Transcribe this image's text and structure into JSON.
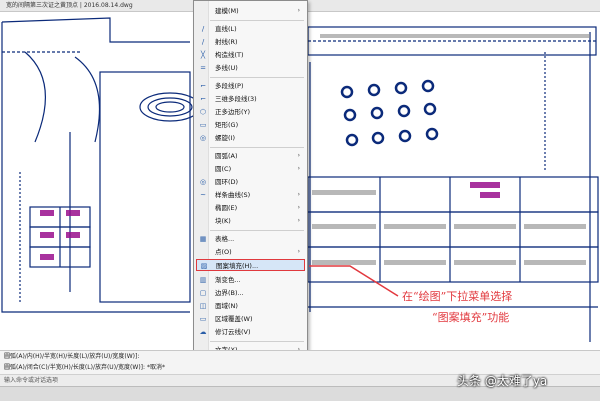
{
  "window": {
    "title": "宽的间隔第三次证之黄顶点 | 2016.08.14.dwg"
  },
  "menu": {
    "items": [
      {
        "label": "建模(M)",
        "arrow": "›",
        "icon": ""
      },
      {
        "label": "直线(L)",
        "arrow": "",
        "icon": "/"
      },
      {
        "label": "射线(R)",
        "arrow": "",
        "icon": "/"
      },
      {
        "label": "构造线(T)",
        "arrow": "",
        "icon": "╳"
      },
      {
        "label": "多线(U)",
        "arrow": "",
        "icon": "="
      },
      {
        "label": "多段线(P)",
        "arrow": "",
        "icon": "⌐"
      },
      {
        "label": "三维多段线(3)",
        "arrow": "",
        "icon": "⌐"
      },
      {
        "label": "正多边形(Y)",
        "arrow": "",
        "icon": "⬡"
      },
      {
        "label": "矩形(G)",
        "arrow": "",
        "icon": "▭"
      },
      {
        "label": "螺旋(I)",
        "arrow": "",
        "icon": "◎"
      },
      {
        "label": "圆弧(A)",
        "arrow": "›",
        "icon": ""
      },
      {
        "label": "圆(C)",
        "arrow": "›",
        "icon": ""
      },
      {
        "label": "圆环(D)",
        "arrow": "",
        "icon": "◎"
      },
      {
        "label": "样条曲线(S)",
        "arrow": "›",
        "icon": "~"
      },
      {
        "label": "椭圆(E)",
        "arrow": "›",
        "icon": ""
      },
      {
        "label": "块(K)",
        "arrow": "›",
        "icon": ""
      },
      {
        "label": "表格...",
        "arrow": "",
        "icon": "▦"
      },
      {
        "label": "点(O)",
        "arrow": "›",
        "icon": ""
      },
      {
        "label": "图案填充(H)...",
        "arrow": "",
        "icon": "▨"
      },
      {
        "label": "渐变色...",
        "arrow": "",
        "icon": "▥"
      },
      {
        "label": "边界(B)...",
        "arrow": "",
        "icon": "▢"
      },
      {
        "label": "面域(N)",
        "arrow": "",
        "icon": "◫"
      },
      {
        "label": "区域覆盖(W)",
        "arrow": "",
        "icon": "▭"
      },
      {
        "label": "修订云线(V)",
        "arrow": "",
        "icon": "☁"
      },
      {
        "label": "文字(X)",
        "arrow": "›",
        "icon": ""
      }
    ],
    "highlighted_index": 18
  },
  "command_line": {
    "line1": "圆弧(A)/内(H)/半宽(H)/长度(L)/放弃(U)/宽度(W)]:",
    "line2": "圆弧(A)/闭合(C)/半宽(H)/长度(L)/放弃(U)/宽度(W)]: *取消*",
    "line3": "输入命令或对话选项"
  },
  "annotation": {
    "line1": "在“绘图”下拉菜单选择",
    "line2": "“图案填充”功能",
    "color": "#e2383e"
  },
  "watermark": "头条 @太难了ya",
  "colors": {
    "drawing_lines": "#0b2a7a",
    "drawing_accent": "#9a0f8e",
    "highlight_border": "#e0393e"
  }
}
